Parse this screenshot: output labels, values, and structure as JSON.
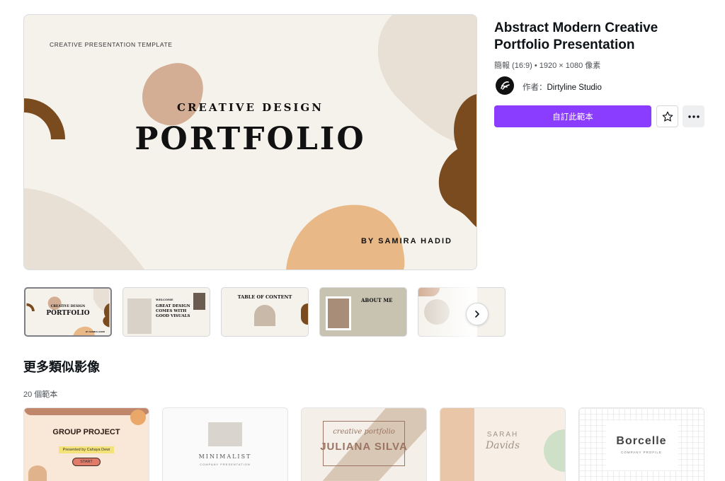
{
  "preview": {
    "eyebrow": "CREATIVE PRESENTATION TEMPLATE",
    "subtitle": "CREATIVE DESIGN",
    "title": "PORTFOLIO",
    "author": "BY SAMIRA HADID"
  },
  "thumbnails": [
    {
      "l1": "CREATIVE DESIGN",
      "l2": "PORTFOLIO",
      "l3": "BY SAMIRA HADID"
    },
    {
      "l1": "WELCOME",
      "l2": "GREAT DESIGN COMES WITH GOOD VISUALS"
    },
    {
      "l1": "TABLE OF CONTENT"
    },
    {
      "l1": "ABOUT ME"
    },
    {
      "l1": ""
    }
  ],
  "template": {
    "title": "Abstract Modern Creative Portfolio Presentation",
    "meta": "簡報 (16:9) • 1920 × 1080 像素",
    "author_label": "作者：",
    "author_name": "Dirtyline Studio",
    "cta_label": "自訂此範本"
  },
  "icons": {
    "star": "star-icon",
    "more": "more-horizontal-icon",
    "next": "chevron-right-icon",
    "avatar": "dirtyline-logo"
  },
  "more_similar": {
    "heading": "更多類似影像",
    "count": "20 個範本",
    "cards": [
      {
        "title": "GROUP PROJECT",
        "subtitle": "Presented by Cahaya Dewi",
        "button": "START"
      },
      {
        "title": "MINIMALIST",
        "subtitle": "COMPANY PRESENTATION"
      },
      {
        "title": "creative portfolio",
        "subtitle": "JULIANA SILVA"
      },
      {
        "title": "SARAH",
        "subtitle": "Davids"
      },
      {
        "title": "Borcelle",
        "subtitle": "COMPANY PROFILE"
      }
    ]
  },
  "colors": {
    "accent": "#8b3dff",
    "brown": "#7a4b1e",
    "tan": "#d3ae95",
    "peach": "#e9b887",
    "cream": "#f5f2ec",
    "beige": "#e8dfd5"
  }
}
